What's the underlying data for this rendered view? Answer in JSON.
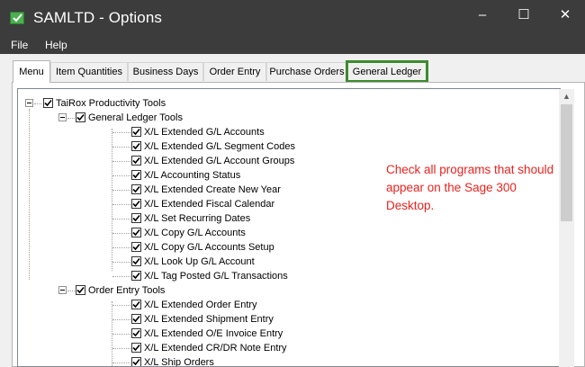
{
  "window": {
    "title": "SAMLTD - Options",
    "minimize": "–",
    "maximize": "☐",
    "close": "✕"
  },
  "menubar": {
    "file": "File",
    "help": "Help"
  },
  "tabs": [
    {
      "label": "Menu"
    },
    {
      "label": "Item Quantities"
    },
    {
      "label": "Business Days"
    },
    {
      "label": "Order Entry"
    },
    {
      "label": "Purchase Orders"
    },
    {
      "label": "General Ledger"
    }
  ],
  "tree": {
    "root": "TaiRox Productivity Tools",
    "groups": [
      {
        "label": "General Ledger Tools",
        "items": [
          "X/L Extended G/L Accounts",
          "X/L Extended G/L Segment Codes",
          "X/L Extended G/L Account Groups",
          "X/L Accounting Status",
          "X/L Extended Create New Year",
          "X/L Extended Fiscal Calendar",
          "X/L Set Recurring Dates",
          "X/L Copy G/L Accounts",
          "X/L Copy G/L Accounts Setup",
          "X/L Look Up G/L Account",
          "X/L Tag Posted G/L Transactions"
        ]
      },
      {
        "label": "Order Entry Tools",
        "items": [
          "X/L Extended Order Entry",
          "X/L Extended Shipment Entry",
          "X/L Extended O/E Invoice Entry",
          "X/L Extended CR/DR Note Entry",
          "X/L Ship Orders"
        ]
      }
    ]
  },
  "annotation": "Check all programs that should appear on the Sage 300 Desktop.",
  "colors": {
    "annotation": "#e8231f",
    "highlight": "#3d8b2e",
    "titlebar": "#3c3c3c"
  }
}
